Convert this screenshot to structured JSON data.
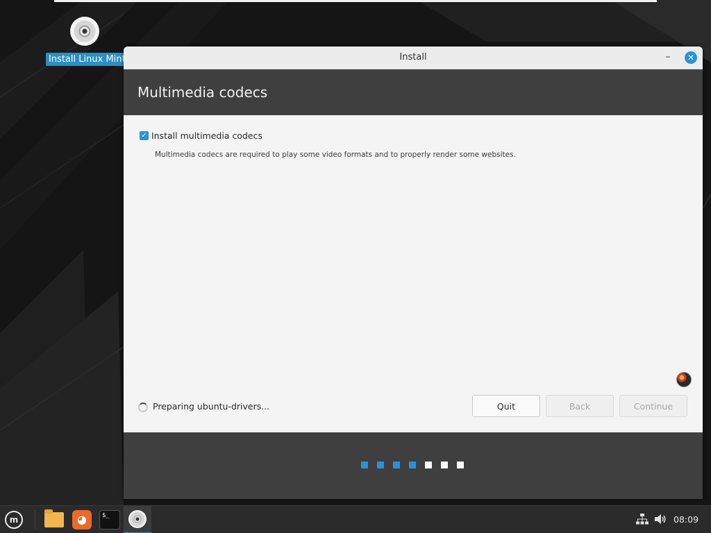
{
  "desktop": {
    "icon_label": "Install Linux Mint"
  },
  "window": {
    "title": "Install",
    "minimize_glyph": "–",
    "close_glyph": "✕",
    "page_title": "Multimedia codecs",
    "checkbox_label": "Install multimedia codecs",
    "checkbox_checked": true,
    "description": "Multimedia codecs are required to play some video formats and to properly render some websites.",
    "status_text": "Preparing ubuntu-drivers...",
    "buttons": {
      "quit": "Quit",
      "back": "Back",
      "continue": "Continue"
    },
    "progress": {
      "completed_steps": 4,
      "total_steps": 7
    }
  },
  "taskbar": {
    "menu_glyph": "m",
    "firefox_glyph": "◕",
    "terminal_glyph": "$_",
    "clock": "08:09"
  },
  "colors": {
    "accent": "#2a93d5",
    "header_band": "#3f3f3f",
    "taskbar": "#2b2b2b"
  },
  "icons": {
    "installer": "disc-icon",
    "files": "folder-icon",
    "browser": "firefox-icon",
    "terminal": "terminal-icon",
    "network": "network-icon",
    "volume": "volume-icon",
    "mint": "linux-mint-logo-icon"
  }
}
